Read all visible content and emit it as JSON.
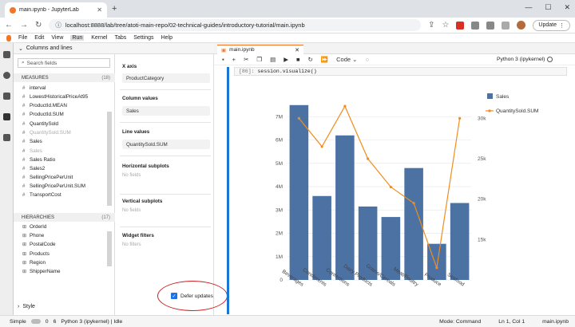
{
  "browser": {
    "tab_title": "main.ipynb - JupyterLab",
    "url": "localhost:8888/lab/tree/atoti-main-repo/02-technical-guides/introductory-tutorial/main.ipynb",
    "update_label": "Update"
  },
  "menu": [
    "File",
    "Edit",
    "View",
    "Run",
    "Kernel",
    "Tabs",
    "Settings",
    "Help"
  ],
  "panel": {
    "header": "Columns and lines",
    "search_placeholder": "Search fields",
    "measures_label": "MEASURES",
    "measures_count": "(18)",
    "measures": [
      "interval",
      "LowestHistoricalPriceAt95",
      "ProductId.MEAN",
      "ProductId.SUM",
      "QuantitySold",
      "QuantitySold.SUM",
      "Sales",
      "Sales Ratio",
      "Sales2",
      "SellingPricePerUnit",
      "SellingPricePerUnit.SUM",
      "TransportCost"
    ],
    "hierarchies_label": "HIERARCHIES",
    "hierarchies_count": "(17)",
    "hierarchies": [
      "OrderId",
      "Phone",
      "PostalCode",
      "Products",
      "Region",
      "ShipperName"
    ],
    "style_label": "Style"
  },
  "wizard": {
    "xaxis_label": "X axis",
    "xaxis_value": "ProductCategory",
    "colvals_label": "Column values",
    "colvals_value": "Sales",
    "linevals_label": "Line values",
    "linevals_value": "QuantitySold.SUM",
    "hsub_label": "Horizontal subplots",
    "hsub_empty": "No fields",
    "vsub_label": "Vertical subplots",
    "vsub_empty": "No fields",
    "filters_label": "Widget filters",
    "filters_empty": "No filters",
    "defer_label": "Defer updates"
  },
  "notebook": {
    "tab": "main.ipynb",
    "cell_type": "Code",
    "kernel": "Python 3 (ipykernel)",
    "prompt": "[86]:",
    "code": "session.visualize()"
  },
  "chart_data": {
    "type": "bar",
    "categories": [
      "Beverages",
      "Condiments",
      "Confections",
      "Dairy Products",
      "Grains/Cereals",
      "Meat/Poultry",
      "Produce",
      "Seafood"
    ],
    "series": [
      {
        "name": "Sales",
        "type": "bar",
        "values": [
          7.5,
          3.6,
          6.2,
          3.15,
          2.7,
          4.8,
          1.55,
          3.3
        ]
      },
      {
        "name": "QuantitySold.SUM",
        "type": "line",
        "values": [
          30,
          26.5,
          31.5,
          25,
          21.5,
          19.5,
          11.5,
          30
        ]
      }
    ],
    "y_left_ticks": [
      "0",
      "1M",
      "2M",
      "3M",
      "4M",
      "5M",
      "6M",
      "7M"
    ],
    "y_left_range": [
      0,
      7.8
    ],
    "y_right_ticks": [
      "15k",
      "20k",
      "25k",
      "30k"
    ],
    "y_right_range": [
      10,
      32.5
    ],
    "legend": "top-right",
    "colors": {
      "bar": "#4c72a4",
      "line": "#f28c1e"
    },
    "grid": true
  },
  "status": {
    "mode_label": "Simple",
    "num1": "0",
    "num2": "6",
    "kernel": "Python 3 (ipykernel) | Idle",
    "mode": "Mode: Command",
    "position": "Ln 1, Col 1",
    "file": "main.ipynb"
  }
}
